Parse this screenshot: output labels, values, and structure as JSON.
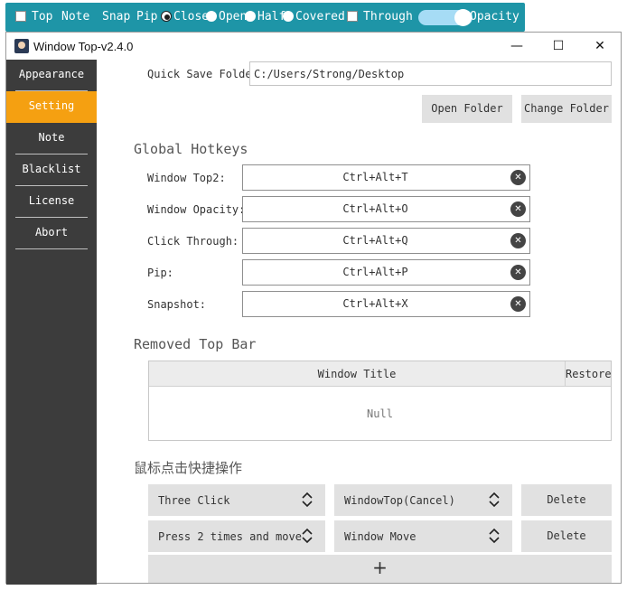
{
  "topbar": {
    "top_label": "Top",
    "note_label": "Note",
    "snap_label": "Snap",
    "pip_label": "Pip",
    "pip_options": [
      "Close",
      "Open",
      "Half",
      "Covered"
    ],
    "pip_selected": "Close",
    "through_label": "Through",
    "opacity_label": "Opacity",
    "toggle_color": "#a6dcf5",
    "bar_color": "#1e95a7"
  },
  "window": {
    "title": "Window Top-v2.4.0",
    "minimize": "—",
    "maximize": "☐",
    "close": "✕"
  },
  "sidebar": {
    "items": [
      {
        "label": "Appearance",
        "active": false
      },
      {
        "label": "Setting",
        "active": true
      },
      {
        "label": "Note",
        "active": false
      },
      {
        "label": "Blacklist",
        "active": false
      },
      {
        "label": "License",
        "active": false
      },
      {
        "label": "Abort",
        "active": false
      }
    ],
    "accent": "#f5a011"
  },
  "settings": {
    "quick_save_label": "Quick Save Folder:",
    "quick_save_value": "C:/Users/Strong/Desktop",
    "open_folder": "Open Folder",
    "change_folder": "Change Folder",
    "hotkeys_title": "Global Hotkeys",
    "hotkeys": [
      {
        "label": "Window Top2:",
        "value": "Ctrl+Alt+T"
      },
      {
        "label": "Window Opacity:",
        "value": "Ctrl+Alt+O"
      },
      {
        "label": "Click Through:",
        "value": "Ctrl+Alt+Q"
      },
      {
        "label": "Pip:",
        "value": "Ctrl+Alt+P"
      },
      {
        "label": "Snapshot:",
        "value": "Ctrl+Alt+X"
      }
    ],
    "removed_title": "Removed Top Bar",
    "table_headers": [
      "Window Title",
      "Restore"
    ],
    "table_empty": "Null",
    "mouse_title": "鼠标点击快捷操作",
    "mouse_rows": [
      {
        "trigger": "Three Click",
        "action": "WindowTop(Cancel)",
        "delete": "Delete"
      },
      {
        "trigger": "Press 2 times and move",
        "action": "Window Move",
        "delete": "Delete"
      }
    ],
    "add_label": "+"
  }
}
